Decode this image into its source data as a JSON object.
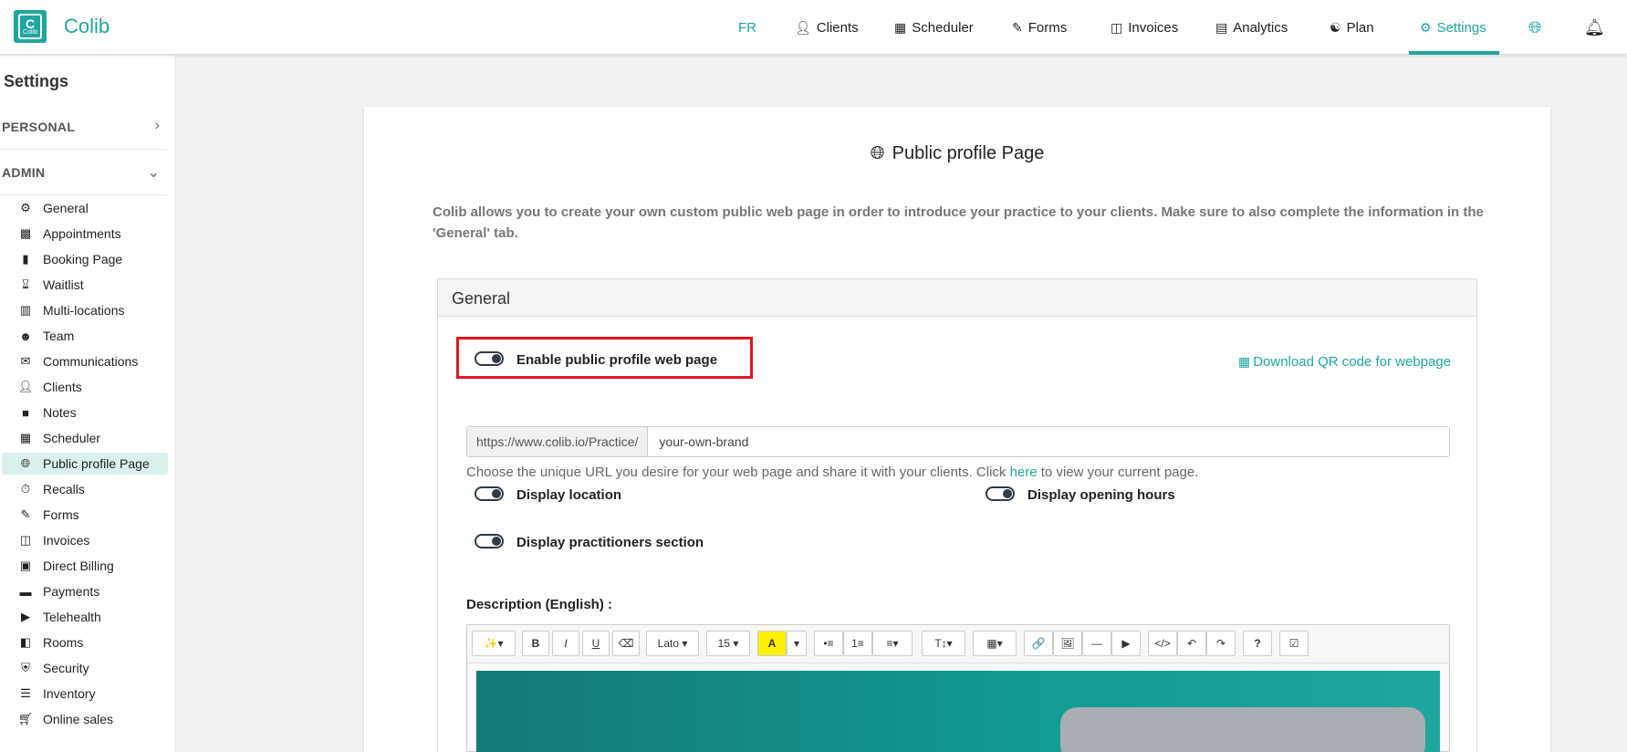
{
  "app": {
    "brand": "Colib",
    "logo_letter": "C",
    "logo_sub": "Colib",
    "accent": "#1fa6a0"
  },
  "nav": {
    "lang": "FR",
    "items": [
      {
        "label": "Clients",
        "icon": "user-icon"
      },
      {
        "label": "Scheduler",
        "icon": "calendar-icon"
      },
      {
        "label": "Forms",
        "icon": "forms-icon"
      },
      {
        "label": "Invoices",
        "icon": "invoice-icon"
      },
      {
        "label": "Analytics",
        "icon": "analytics-icon"
      },
      {
        "label": "Plan",
        "icon": "handshake-icon"
      },
      {
        "label": "Settings",
        "icon": "gear-icon",
        "active": true
      }
    ]
  },
  "sidebar": {
    "title": "Settings",
    "personal": "PERSONAL",
    "admin": "ADMIN",
    "items": [
      {
        "label": "General",
        "icon": "gear-icon"
      },
      {
        "label": "Appointments",
        "icon": "appointment-icon"
      },
      {
        "label": "Booking Page",
        "icon": "clipboard-icon"
      },
      {
        "label": "Waitlist",
        "icon": "hourglass-icon"
      },
      {
        "label": "Multi-locations",
        "icon": "building-icon"
      },
      {
        "label": "Team",
        "icon": "team-icon"
      },
      {
        "label": "Communications",
        "icon": "chat-icon"
      },
      {
        "label": "Clients",
        "icon": "user-icon"
      },
      {
        "label": "Notes",
        "icon": "note-icon"
      },
      {
        "label": "Scheduler",
        "icon": "calendar-icon"
      },
      {
        "label": "Public profile Page",
        "icon": "globe-icon",
        "active": true
      },
      {
        "label": "Recalls",
        "icon": "stopwatch-icon"
      },
      {
        "label": "Forms",
        "icon": "forms-icon"
      },
      {
        "label": "Invoices",
        "icon": "invoice-icon"
      },
      {
        "label": "Direct Billing",
        "icon": "billing-icon"
      },
      {
        "label": "Payments",
        "icon": "credit-card-icon"
      },
      {
        "label": "Telehealth",
        "icon": "video-icon"
      },
      {
        "label": "Rooms",
        "icon": "door-icon"
      },
      {
        "label": "Security",
        "icon": "shield-icon"
      },
      {
        "label": "Inventory",
        "icon": "list-icon"
      },
      {
        "label": "Online sales",
        "icon": "cart-icon"
      }
    ]
  },
  "main": {
    "title": "Public profile Page",
    "intro": "Colib allows you to create your own custom public web page in order to introduce your practice to your clients. Make sure to also complete the information in the 'General' tab.",
    "panel_title": "General",
    "enable_label": "Enable public profile web page",
    "qr_link": "Download QR code for webpage",
    "url_prefix": "https://www.colib.io/Practice/",
    "url_value": "your-own-brand",
    "help_before": "Choose the unique URL you desire for your web page and share it with your clients. Click ",
    "help_link": "here",
    "help_after": " to view your current page.",
    "display_location": "Display location",
    "display_opening_hours": "Display opening hours",
    "display_practitioners": "Display practitioners section",
    "description_label": "Description (English) :"
  },
  "editor": {
    "font": "Lato",
    "size": "15",
    "buttons": [
      "✨▾",
      "B",
      "I",
      "U",
      "⌫",
      "Lato ▾",
      "15 ▾",
      "A",
      "▾",
      "•≡",
      "1≡",
      "≡▾",
      "T↕▾",
      "▦▾",
      "🔗",
      "🖼",
      "—",
      "▶",
      "</>",
      "↶",
      "↷",
      "?",
      "☑"
    ]
  }
}
